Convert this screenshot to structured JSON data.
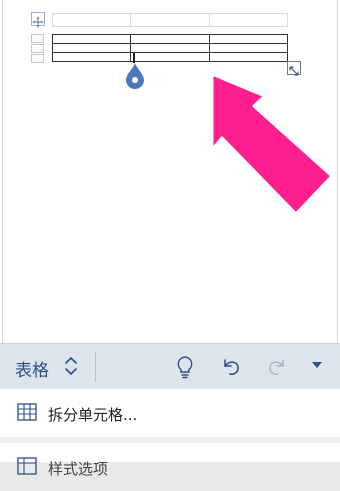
{
  "toolbar": {
    "tab_label": "表格",
    "tab_switch_icon": "chevron-up-down-icon",
    "ideas_icon": "lightbulb-icon",
    "undo_icon": "undo-icon",
    "redo_icon": "redo-icon",
    "more_icon": "caret-down-icon"
  },
  "menu": {
    "items": [
      {
        "label": "拆分单元格...",
        "icon": "split-cells-icon"
      },
      {
        "label": "样式选项",
        "icon": "table-style-icon"
      }
    ]
  },
  "colors": {
    "accent": "#2b4f86",
    "arrow": "#ff1f8e",
    "toolbar_bg": "#dde4ec",
    "handle": "#4a78b8"
  }
}
